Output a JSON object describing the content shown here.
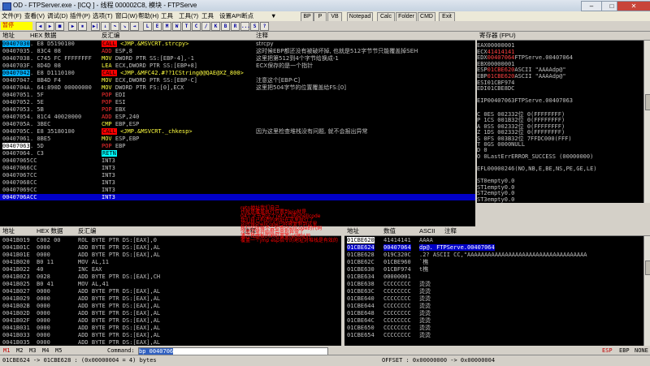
{
  "window": {
    "title": "OD - FTPServer.exe - [ICQ ] - 线程 000002C8, 模块 - FTPServe",
    "minimize": "–",
    "maximize": "□",
    "close": "✕"
  },
  "menu": {
    "items": [
      "文件(F)",
      "查看(V)",
      "调试(D)",
      "插件(P)",
      "选项(T)",
      "窗口(W)",
      "帮助(H)",
      "工具",
      "工具(?)",
      "工具",
      "设置API断点"
    ],
    "arrow": "▼",
    "buttons": [
      "BP",
      "P",
      "VB",
      "Notepad",
      "Calc",
      "Folder",
      "CMD",
      "Exit"
    ]
  },
  "toolbar": {
    "status": "暂停",
    "buttons": [
      "◀",
      "▶",
      "■",
      "▶",
      "⏸",
      "▶|",
      "↓",
      "↷",
      "↘",
      "⇥",
      "L",
      "E",
      "M",
      "W",
      "T",
      "C",
      "/",
      "K",
      "B",
      "R",
      "...",
      "S",
      "?"
    ]
  },
  "cpu": {
    "headers": [
      "地址",
      "HEX 数据",
      "反汇编",
      "注释"
    ],
    "rows": [
      {
        "addr": "00407030",
        "hex": ". E8 D5190100",
        "asm": "CALL <JMP.&MSVCRT.strcpy>",
        "kind": "call",
        "comment": "strcpy",
        "style": "sel-addr"
      },
      {
        "addr": "00407035",
        "hex": ". 83C4 08",
        "asm": "ADD ESP,8",
        "kind": "red",
        "comment": "这时候EBP都还没有被破坏掉, 也就是512字节节只能覆盖掉SEH"
      },
      {
        "addr": "00407038",
        "hex": ". C745 FC FFFFFFFF",
        "asm": "MOV DWORD PTR SS:[EBP-4],-1",
        "kind": "yellow",
        "comment": "这里把第512到4个字节给换成-1"
      },
      {
        "addr": "0040703F",
        "hex": ". 8D4D 08",
        "asm": "LEA ECX,DWORD PTR SS:[EBP+8]",
        "kind": "yellow",
        "comment": "ECX保存的是一个指针"
      },
      {
        "addr": "00407042",
        "hex": ". E8 D1110100",
        "asm": "CALL <JMP.&MFC42.#??1CString@@QAE@XZ_800>",
        "kind": "call",
        "comment": "",
        "style": "sel-addr"
      },
      {
        "addr": "00407047",
        "hex": ". 8B4D F4",
        "asm": "MOV ECX,DWORD PTR SS:[EBP-C]",
        "kind": "yellow",
        "comment": "注意这个[EBP-C]"
      },
      {
        "addr": "0040704A",
        "hex": ". 64:890D 00000000",
        "asm": "MOV DWORD PTR FS:[0],ECX",
        "kind": "yellow",
        "comment": "这里把504字节的位置覆盖给FS:[0]"
      },
      {
        "addr": "00407051",
        "hex": ". 5F",
        "asm": "POP EDI",
        "kind": "red",
        "comment": ""
      },
      {
        "addr": "00407052",
        "hex": ". 5E",
        "asm": "POP ESI",
        "kind": "red",
        "comment": ""
      },
      {
        "addr": "00407053",
        "hex": ". 5B",
        "asm": "POP EBX",
        "kind": "red",
        "comment": ""
      },
      {
        "addr": "00407054",
        "hex": ". 81C4 40020000",
        "asm": "ADD ESP,240",
        "kind": "red",
        "comment": ""
      },
      {
        "addr": "0040705A",
        "hex": ". 3BEC",
        "asm": "CMP EBP,ESP",
        "kind": "yellow",
        "comment": ""
      },
      {
        "addr": "0040705C",
        "hex": ". E8 35180100",
        "asm": "CALL <JMP.&MSVCRT._chkesp>",
        "kind": "call",
        "comment": "因为这里检查堆栈没有问题, 就不会报出异常"
      },
      {
        "addr": "00407061",
        "hex": ". 8BE5",
        "asm": "MOV ESP,EBP",
        "kind": "yellow",
        "comment": ""
      },
      {
        "addr": "00407063",
        "hex": ". 5D",
        "asm": "POP EBP",
        "kind": "red",
        "comment": "",
        "style": "box-addr"
      },
      {
        "addr": "00407064",
        "hex": ". C3",
        "asm": "RETN",
        "kind": "jmp",
        "comment": ""
      },
      {
        "addr": "00407065",
        "hex": "CC",
        "asm": "INT3",
        "kind": "plain",
        "comment": ""
      },
      {
        "addr": "00407066",
        "hex": "CC",
        "asm": "INT3",
        "kind": "plain",
        "comment": ""
      },
      {
        "addr": "00407067",
        "hex": "CC",
        "asm": "INT3",
        "kind": "plain",
        "comment": ""
      },
      {
        "addr": "00407068",
        "hex": "CC",
        "asm": "INT3",
        "kind": "plain",
        "comment": ""
      },
      {
        "addr": "00407069",
        "hex": "CC",
        "asm": "INT3",
        "kind": "plain",
        "comment": ""
      },
      {
        "addr": "0040706A",
        "hex": "CC",
        "asm": "INT3",
        "kind": "plain",
        "comment": "",
        "style": "sel-row"
      }
    ]
  },
  "registers": {
    "header": "寄存器 (FPU)",
    "lines": [
      {
        "name": "EAX",
        "value": "00000001",
        "extra": ""
      },
      {
        "name": "ECX",
        "value": "41414141",
        "extra": ""
      },
      {
        "name": "EDX",
        "value": "00407064",
        "extra": "FTPServe.00407064"
      },
      {
        "name": "EBX",
        "value": "00000001",
        "extra": ""
      },
      {
        "name": "ESP",
        "value": "01CBE620",
        "extra": "ASCII \"AAAAdp@\""
      },
      {
        "name": "EBP",
        "value": "01CBE620",
        "extra": "ASCII \"AAAAdp@\""
      },
      {
        "name": "ESI",
        "value": "01CBF974",
        "extra": ""
      },
      {
        "name": "EDI",
        "value": "01CBE8DC",
        "extra": ""
      },
      {
        "name": "",
        "value": "",
        "extra": ""
      },
      {
        "name": "EIP",
        "value": "00407063",
        "extra": "FTPServe.00407063"
      },
      {
        "name": "",
        "value": "",
        "extra": ""
      },
      {
        "name": "C 0",
        "value": "ES 0023",
        "extra": "32位 0(FFFFFFFF)"
      },
      {
        "name": "P 1",
        "value": "CS 001B",
        "extra": "32位 0(FFFFFFFF)"
      },
      {
        "name": "A 0",
        "value": "SS 0023",
        "extra": "32位 0(FFFFFFFF)"
      },
      {
        "name": "Z 1",
        "value": "DS 0023",
        "extra": "32位 0(FFFFFFFF)"
      },
      {
        "name": "S 0",
        "value": "FS 003B",
        "extra": "32位 7FFDC000(FFF)"
      },
      {
        "name": "T 0",
        "value": "GS 0000",
        "extra": "NULL"
      },
      {
        "name": "D 0",
        "value": "",
        "extra": ""
      },
      {
        "name": "O 0",
        "value": "LastErr",
        "extra": "ERROR_SUCCESS (00000000)"
      },
      {
        "name": "",
        "value": "",
        "extra": ""
      },
      {
        "name": "EFL",
        "value": "00000246",
        "extra": "(NO,NB,E,BE,NS,PE,GE,LE)"
      },
      {
        "name": "",
        "value": "",
        "extra": ""
      },
      {
        "name": "ST0",
        "value": "empty",
        "extra": "0.0"
      },
      {
        "name": "ST1",
        "value": "empty",
        "extra": "0.0"
      },
      {
        "name": "ST2",
        "value": "empty",
        "extra": "0.0"
      },
      {
        "name": "ST3",
        "value": "empty",
        "extra": "0.0"
      }
    ]
  },
  "dump": {
    "headers": [
      "地址",
      "HEX 数据",
      "反汇编",
      "注释"
    ],
    "rows": [
      {
        "addr": "0041B019",
        "hex": "C002 00",
        "asm": "ROL BYTE PTR DS:[EAX],0"
      },
      {
        "addr": "0041B01C",
        "hex": "0000",
        "asm": "ADD BYTE PTR DS:[EAX],AL"
      },
      {
        "addr": "0041B01E",
        "hex": "0000",
        "asm": "ADD BYTE PTR DS:[EAX],AL"
      },
      {
        "addr": "0041B020",
        "hex": "B0 11",
        "asm": "MOV AL,11"
      },
      {
        "addr": "0041B022",
        "hex": "40",
        "asm": "INC EAX"
      },
      {
        "addr": "0041B023",
        "hex": "0028",
        "asm": "ADD BYTE PTR DS:[EAX],CH"
      },
      {
        "addr": "0041B025",
        "hex": "B0 41",
        "asm": "MOV AL,41"
      },
      {
        "addr": "0041B027",
        "hex": "0000",
        "asm": "ADD BYTE PTR DS:[EAX],AL"
      },
      {
        "addr": "0041B029",
        "hex": "0000",
        "asm": "ADD BYTE PTR DS:[EAX],AL"
      },
      {
        "addr": "0041B02B",
        "hex": "0000",
        "asm": "ADD BYTE PTR DS:[EAX],AL"
      },
      {
        "addr": "0041B02D",
        "hex": "0000",
        "asm": "ADD BYTE PTR DS:[EAX],AL"
      },
      {
        "addr": "0041B02F",
        "hex": "0000",
        "asm": "ADD BYTE PTR DS:[EAX],AL"
      },
      {
        "addr": "0041B031",
        "hex": "0000",
        "asm": "ADD BYTE PTR DS:[EAX],AL"
      },
      {
        "addr": "0041B033",
        "hex": "0000",
        "asm": "ADD BYTE PTR DS:[EAX],AL"
      },
      {
        "addr": "0041B035",
        "hex": "0000",
        "asm": "ADD BYTE PTR DS:[EAX],AL"
      }
    ]
  },
  "stack": {
    "headers": [
      "地址",
      "数值",
      "ASCII",
      "注释"
    ],
    "rows": [
      {
        "addr": "01CBE620",
        "value": "41414141",
        "ascii": "AAAA",
        "sel": true
      },
      {
        "addr": "01CBE624",
        "value": "00407064",
        "ascii": "dp@. FTPServe.00407064",
        "sel": true
      },
      {
        "addr": "01CBE628",
        "value": "019C320C",
        "ascii": ".2? ASCII CC,\"AAAAAAAAAAAAAAAAAAAAAAAAAAAAAAAAAAA"
      },
      {
        "addr": "01CBE62C",
        "value": "01CBE960",
        "ascii": "`樵"
      },
      {
        "addr": "01CBE630",
        "value": "01CBF974",
        "ascii": "t樵"
      },
      {
        "addr": "01CBE634",
        "value": "00000001",
        "ascii": ""
      },
      {
        "addr": "01CBE638",
        "value": "CCCCCCCC",
        "ascii": "烫烫"
      },
      {
        "addr": "01CBE63C",
        "value": "CCCCCCCC",
        "ascii": "烫烫"
      },
      {
        "addr": "01CBE640",
        "value": "CCCCCCCC",
        "ascii": "烫烫"
      },
      {
        "addr": "01CBE644",
        "value": "CCCCCCCC",
        "ascii": "烫烫"
      },
      {
        "addr": "01CBE648",
        "value": "CCCCCCCC",
        "ascii": "烫烫"
      },
      {
        "addr": "01CBE64C",
        "value": "CCCCCCCC",
        "ascii": "烫烫"
      },
      {
        "addr": "01CBE650",
        "value": "CCCCCCCC",
        "ascii": "烫烫"
      },
      {
        "addr": "01CBE654",
        "value": "CCCCCCCC",
        "ascii": "烫烫"
      }
    ]
  },
  "annotation": {
    "lines": [
      "retn地址我们自己",
      "也就是覆盖执行位置到eip就是",
      "04个字节到这个ret入口的shellcode",
      "我们自己构造的地址在这里就行了",
      "这时候shellcode已经被复制到这里",
      "执行的时候不会检查shellcode的代码",
      "注意这里开始就会出现异常了",
      "通过找跳板的地址覆盖ret地址的",
      "覆盖一个jmp esp指令的地址对堆栈是有效的"
    ]
  },
  "cmdbar": {
    "tabs": [
      "M1",
      "M2",
      "M3",
      "M4",
      "M5"
    ],
    "label": "Command:",
    "value": "bp 0040706",
    "right": [
      "ESP",
      "EBP",
      "NONE"
    ]
  },
  "statusbar": {
    "left": "01CBE624 -> 01CBE628 : (0x00000004 = 4) bytes",
    "right": "OFFSET : 0x00000000 -> 0x00000004"
  }
}
